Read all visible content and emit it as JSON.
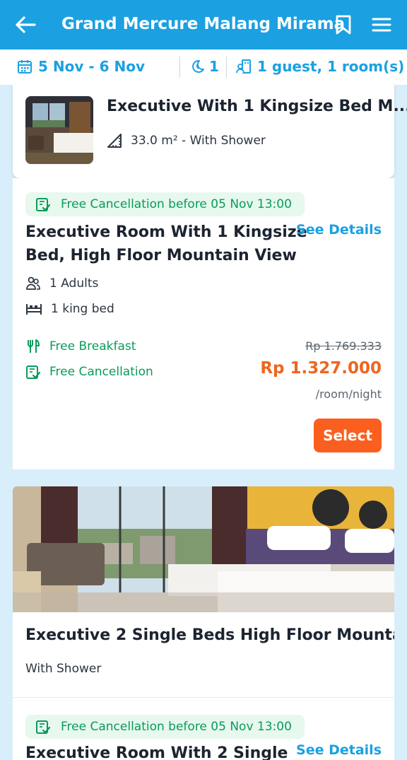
{
  "header": {
    "title": "Grand Mercure Malang Mirama",
    "back_icon": "back-arrow-icon",
    "bookmark_icon": "bookmark-icon",
    "menu_icon": "hamburger-menu-icon"
  },
  "filters": {
    "dates": "5 Nov - 6 Nov",
    "nights": "1",
    "guests": "1 guest, 1 room(s)"
  },
  "room1": {
    "title": "Executive With 1 Kingsize Bed M...",
    "size": "33.0 m² - With Shower",
    "offer": {
      "badge": "Free Cancellation before 05 Nov 13:00",
      "title_line1": "Executive Room With 1 Kingsize",
      "title_line2": "Bed, High Floor Mountain View",
      "see_details": "See Details",
      "adults": "1 Adults",
      "bed": "1 king bed",
      "breakfast": "Free Breakfast",
      "cancellation": "Free Cancellation",
      "original_price": "Rp 1.769.333",
      "price": "Rp 1.327.000",
      "unit": "/room/night",
      "select_label": "Select"
    }
  },
  "room2": {
    "title": "Executive 2 Single Beds High Floor Mounta...",
    "subtitle": "With Shower",
    "offer": {
      "badge": "Free Cancellation before 05 Nov 13:00",
      "title_line1": "Executive Room With 2 Single",
      "see_details": "See Details"
    }
  },
  "colors": {
    "primary": "#1ba0e2",
    "accent": "#fa5f1f",
    "price": "#f0651e",
    "success": "#0b9a5a"
  }
}
